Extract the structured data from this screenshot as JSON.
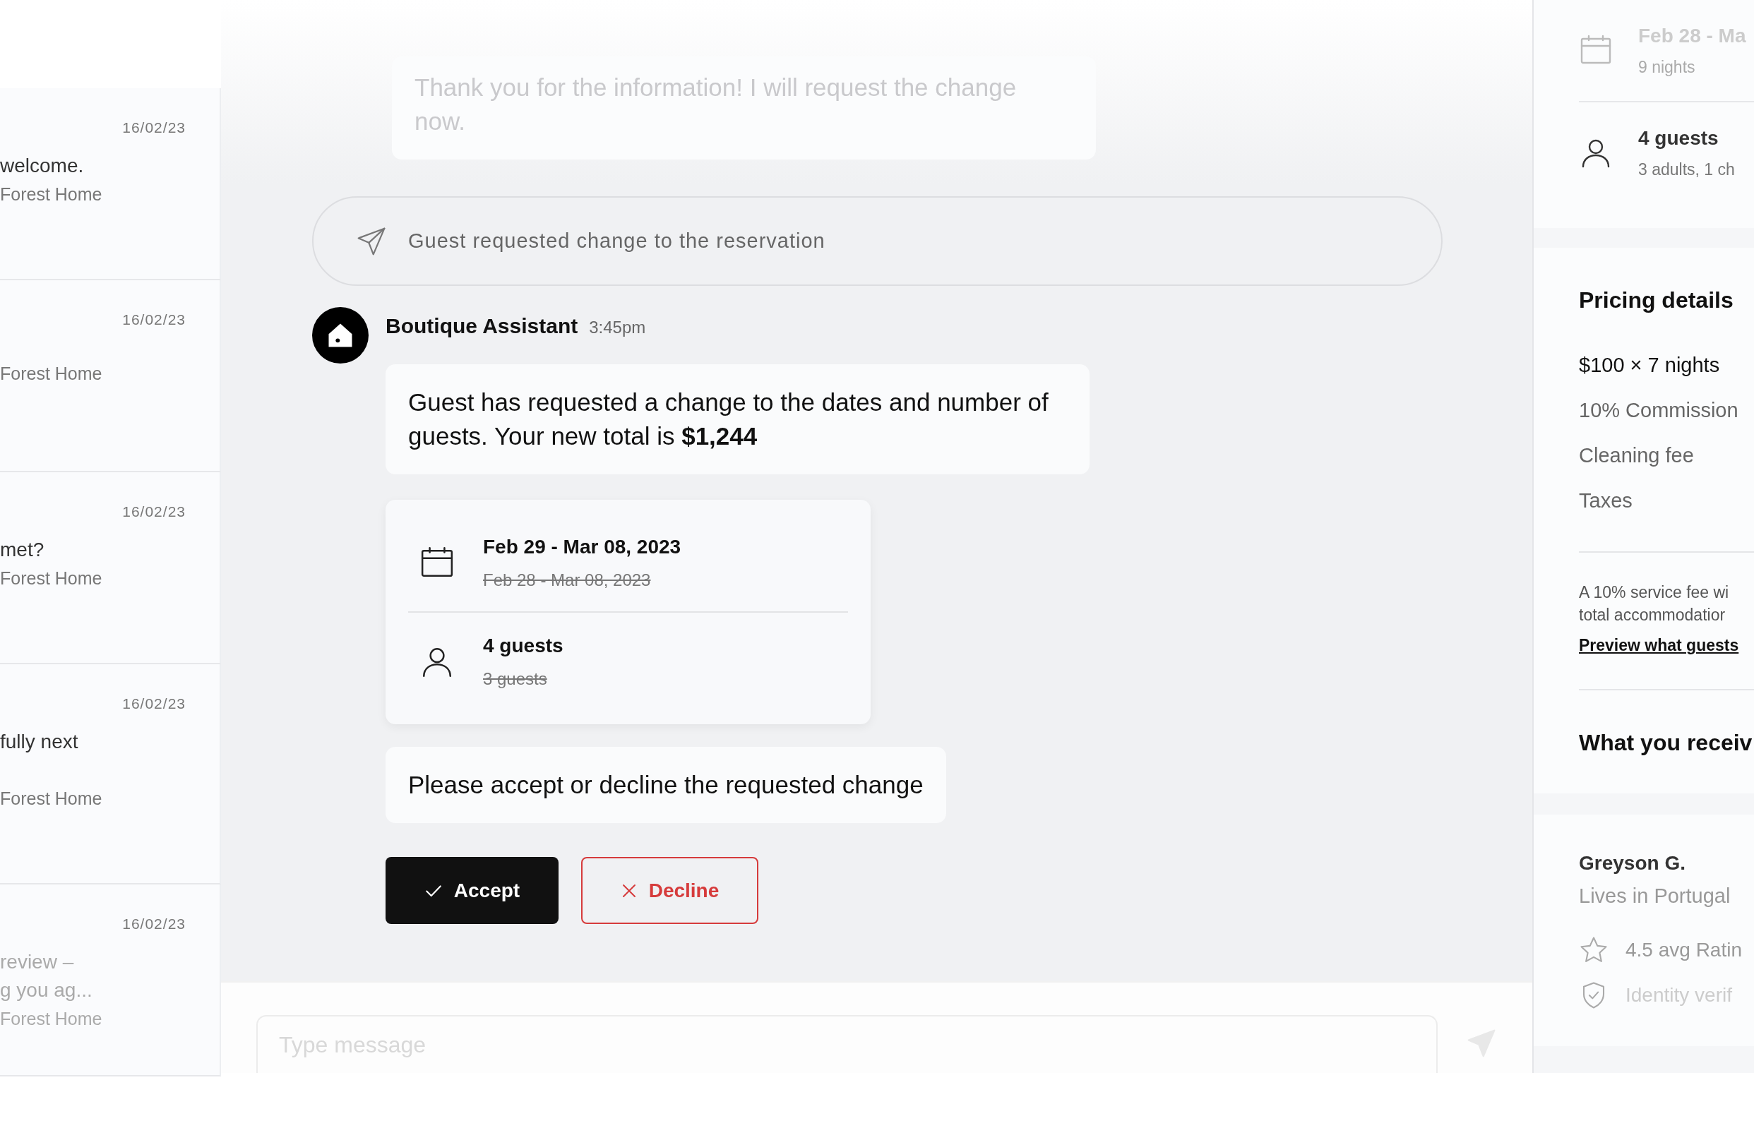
{
  "conversations": [
    {
      "date": "16/02/23",
      "message_lines": [
        "welcome."
      ],
      "property": "Forest Home"
    },
    {
      "date": "16/02/23",
      "property": "Forest Home"
    },
    {
      "date": "16/02/23",
      "message_lines": [
        "met?"
      ],
      "property": "Forest Home"
    },
    {
      "date": "16/02/23",
      "message_lines": [
        "fully next"
      ],
      "property": "Forest Home"
    },
    {
      "date": "16/02/23",
      "message_lines": [
        "review –",
        "g you ag..."
      ],
      "property": "Forest Home"
    }
  ],
  "chat": {
    "previous_message": "Thank you for the information! I will request the change now.",
    "system_notice": "Guest requested change to the reservation",
    "sender": {
      "name": "Boutique Assistant",
      "time": "3:45pm"
    },
    "request_message": "Guest has requested a change to the dates and number of guests. Your new total is **$1,244**",
    "changes": [
      {
        "kind": "dates",
        "new": "Feb 29 - Mar 08, 2023",
        "old": "Feb 28 - Mar 08, 2023"
      },
      {
        "kind": "guests",
        "new": "4 guests",
        "old": "3 guests"
      }
    ],
    "prompt": "Please accept or decline the requested change",
    "buttons": [
      {
        "kind": "accept",
        "label": "Accept"
      },
      {
        "kind": "decline",
        "label": "Decline"
      }
    ],
    "composer": {
      "placeholder": "Type message"
    }
  },
  "booking": [
    {
      "kind": "dates",
      "title": "Feb 28 - Ma",
      "detail": "9 nights"
    },
    {
      "kind": "guests",
      "title": "4 guests",
      "detail": "3 adults, 1 ch"
    }
  ],
  "pricing": {
    "title": "Pricing details",
    "rows": [
      "$100 × 7 nights",
      "10% Commission",
      "Cleaning fee",
      "Taxes"
    ],
    "note_lines": [
      "A 10% service fee wi",
      "total accommodatior"
    ],
    "link": "Preview what guests",
    "receive_title": "What you receiv"
  },
  "host": {
    "name": "Greyson G.",
    "location": "Lives in Portugal",
    "facts": [
      {
        "kind": "rating",
        "text": "4.5 avg Ratin"
      },
      {
        "kind": "identity",
        "text": "Identity verif"
      }
    ]
  }
}
